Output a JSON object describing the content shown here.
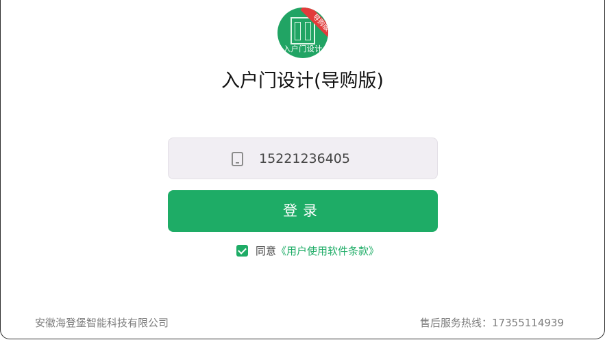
{
  "logo": {
    "ribbon_text": "导购版",
    "text": "入户门设计"
  },
  "app_title": "入户门设计(导购版)",
  "phone_field": {
    "value": "15221236405",
    "icon": "phone-icon"
  },
  "login_button": {
    "label": "登录"
  },
  "agreement": {
    "prefix": "同意",
    "link_text": "《用户使用软件条款》",
    "checked": true
  },
  "footer": {
    "company": "安徽海登堡智能科技有限公司",
    "hotline_label": "售后服务热线：",
    "hotline_number": "17355114939"
  },
  "colors": {
    "brand_green": "#1eac66",
    "ribbon_red": "#e23b3b",
    "field_bg": "#f1eef3"
  }
}
